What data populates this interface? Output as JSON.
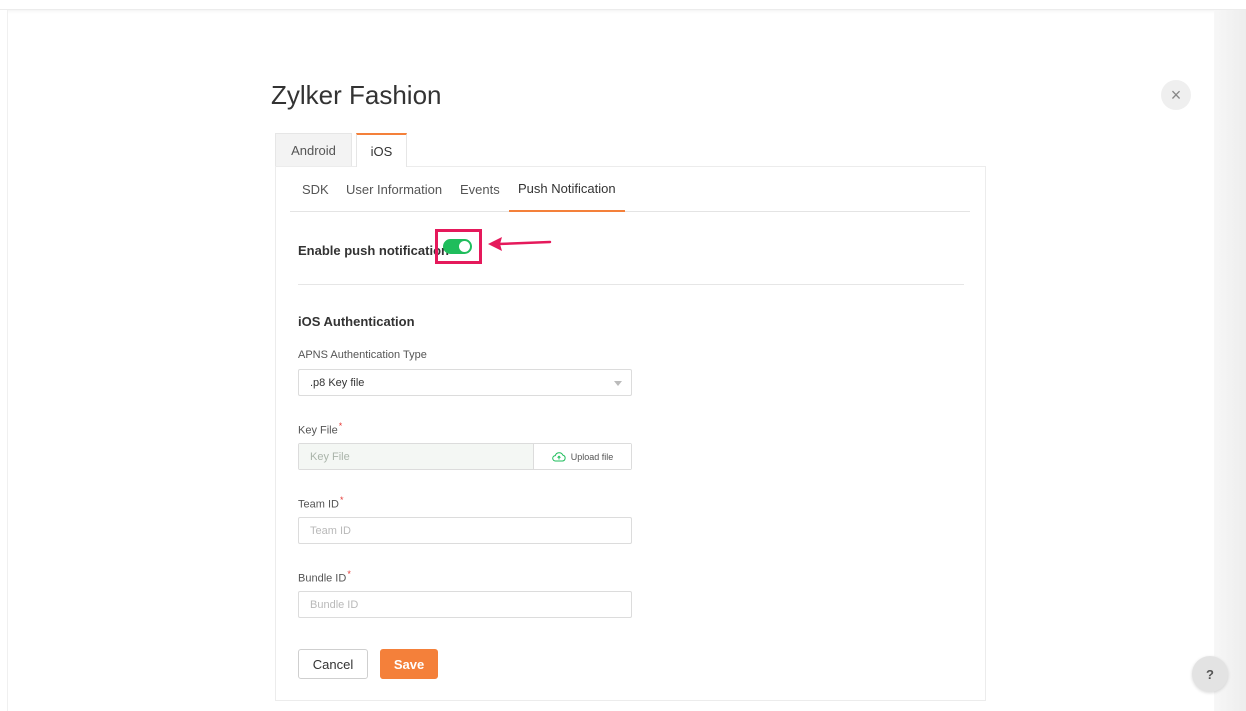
{
  "page": {
    "title": "Zylker Fashion",
    "close_glyph": "×",
    "help_glyph": "?"
  },
  "os_tabs": [
    {
      "label": "Android",
      "active": false
    },
    {
      "label": "iOS",
      "active": true
    }
  ],
  "sub_tabs": [
    {
      "label": "SDK",
      "active": false
    },
    {
      "label": "User Information",
      "active": false
    },
    {
      "label": "Events",
      "active": false
    },
    {
      "label": "Push Notification",
      "active": true
    }
  ],
  "push": {
    "enable_label": "Enable push notification",
    "enabled": true
  },
  "auth": {
    "section_title": "iOS Authentication",
    "type_label": "APNS Authentication Type",
    "type_value": ".p8 Key file",
    "key_file_label": "Key File",
    "key_file_placeholder": "Key File",
    "upload_label": "Upload file",
    "team_id_label": "Team ID",
    "team_id_placeholder": "Team ID",
    "bundle_id_label": "Bundle ID",
    "bundle_id_placeholder": "Bundle ID",
    "required_mark": "*"
  },
  "actions": {
    "cancel_label": "Cancel",
    "save_label": "Save"
  },
  "colors": {
    "accent": "#f4803a",
    "toggle_on": "#1fbd5c",
    "annotation": "#e5195b",
    "required": "#e53935"
  },
  "icons": {
    "close": "close-icon",
    "upload": "cloud-upload-icon",
    "dropdown": "caret-down-icon",
    "help": "help-icon",
    "annotation_arrow": "arrow-left-icon"
  }
}
